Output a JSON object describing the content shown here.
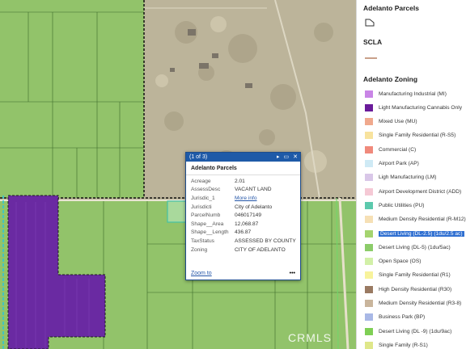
{
  "legend": {
    "parcels_title": "Adelanto Parcels",
    "scla_title": "SCLA",
    "zoning_title": "Adelanto Zoning",
    "items": [
      {
        "label": "Manufacturing Industrial (MI)",
        "color": "#c985e6"
      },
      {
        "label": "Light Manufacturing Cannabis Only",
        "color": "#6a1b9a"
      },
      {
        "label": "Mixed Use (MU)",
        "color": "#f0a98d"
      },
      {
        "label": "Single Family Residential (R-S5)",
        "color": "#f8e39e"
      },
      {
        "label": "Commercial (C)",
        "color": "#f08a7c"
      },
      {
        "label": "Airport Park (AP)",
        "color": "#cfeaf5"
      },
      {
        "label": "Ligh Manufacturing (LM)",
        "color": "#d9c7e8"
      },
      {
        "label": "Airport Development District (ADD)",
        "color": "#f5c9d5"
      },
      {
        "label": "Public Utilities (PU)",
        "color": "#5cc9ad"
      },
      {
        "label": "Medium Density Residential (R-M12)",
        "color": "#f6e0b5"
      },
      {
        "label": "Desert Living (DL-2.5) (1du/2.5 ac)",
        "color": "#a5d46f",
        "selected": true
      },
      {
        "label": "Desert Living (DL-5) (1du/5ac)",
        "color": "#8ccc6a"
      },
      {
        "label": "Open Space (OS)",
        "color": "#d2f0a8"
      },
      {
        "label": "Single Family Residential (R1)",
        "color": "#f8f39c"
      },
      {
        "label": "High Density Residential (R30)",
        "color": "#9a7a62"
      },
      {
        "label": "Medium Density Residential (R3-8)",
        "color": "#c9b59c"
      },
      {
        "label": "Business Park (BP)",
        "color": "#a9b8e6"
      },
      {
        "label": "Desert Living (DL -9) (1du/9ac)",
        "color": "#7fcf55"
      },
      {
        "label": "Single Family (R-S1)",
        "color": "#dfe78a"
      }
    ]
  },
  "popup": {
    "counter": "(1 of 3)",
    "title": "Adelanto Parcels",
    "rows": [
      {
        "key": "Acreage",
        "value": "2.01"
      },
      {
        "key": "AssessDesc",
        "value": "VACANT LAND"
      },
      {
        "key": "Jurisdic_1",
        "value": "More info",
        "link": true
      },
      {
        "key": "Jurisdicti",
        "value": "City of Adelanto"
      },
      {
        "key": "ParcelNumb",
        "value": "046017149"
      },
      {
        "key": "Shape__Area",
        "value": "12,068.87"
      },
      {
        "key": "Shape__Length",
        "value": "436.87"
      },
      {
        "key": "TaxStatus",
        "value": "ASSESSED BY COUNTY"
      },
      {
        "key": "Zoning",
        "value": "CITY OF ADELANTO"
      }
    ],
    "zoom_label": "Zoom to",
    "more_label": "•••",
    "next_glyph": "▸",
    "dock_glyph": "▭",
    "close_glyph": "✕"
  },
  "watermark": "CRMLS"
}
